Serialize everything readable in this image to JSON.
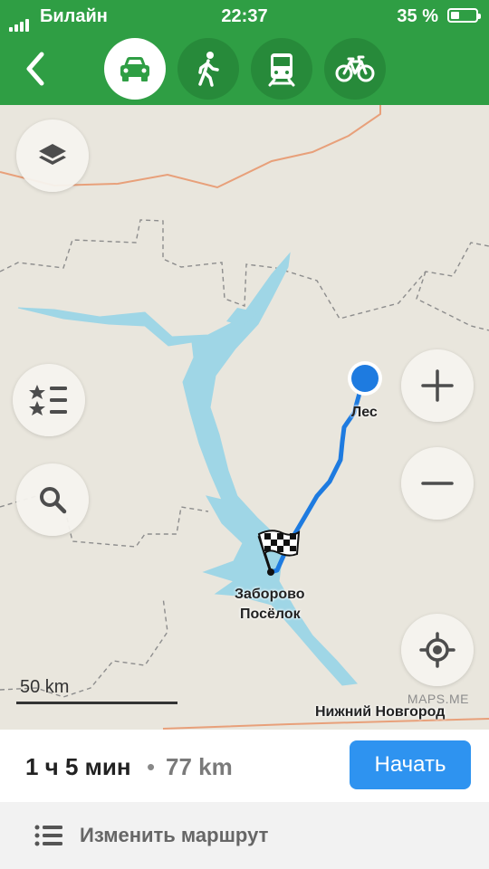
{
  "status_bar": {
    "carrier": "Билайн",
    "time": "22:37",
    "battery_percent": "35 %",
    "battery_level": 0.35
  },
  "toolbar": {
    "back_icon": "chevron-left-icon",
    "modes": [
      {
        "name": "car",
        "icon": "car-icon",
        "active": true
      },
      {
        "name": "walk",
        "icon": "pedestrian-icon",
        "active": false
      },
      {
        "name": "transit",
        "icon": "train-icon",
        "active": false
      },
      {
        "name": "bike",
        "icon": "bicycle-icon",
        "active": false
      }
    ]
  },
  "map": {
    "labels": {
      "start": "Лес",
      "destination_line1": "Заборово",
      "destination_line2": "Посёлок",
      "city": "Нижний Новгород"
    },
    "scale_text": "50 km",
    "attribution": "MAPS.ME",
    "colors": {
      "water": "#9fd6e6",
      "route": "#1e7be0",
      "border": "#e8a07a",
      "background": "#e9e6dd"
    }
  },
  "route": {
    "duration": "1 ч 5 мин",
    "separator": "•",
    "distance": "77 km",
    "start_label": "Начать"
  },
  "edit_route": {
    "label": "Изменить маршрут"
  },
  "colors": {
    "header": "#2f9e44",
    "start_button": "#2e93f0"
  }
}
